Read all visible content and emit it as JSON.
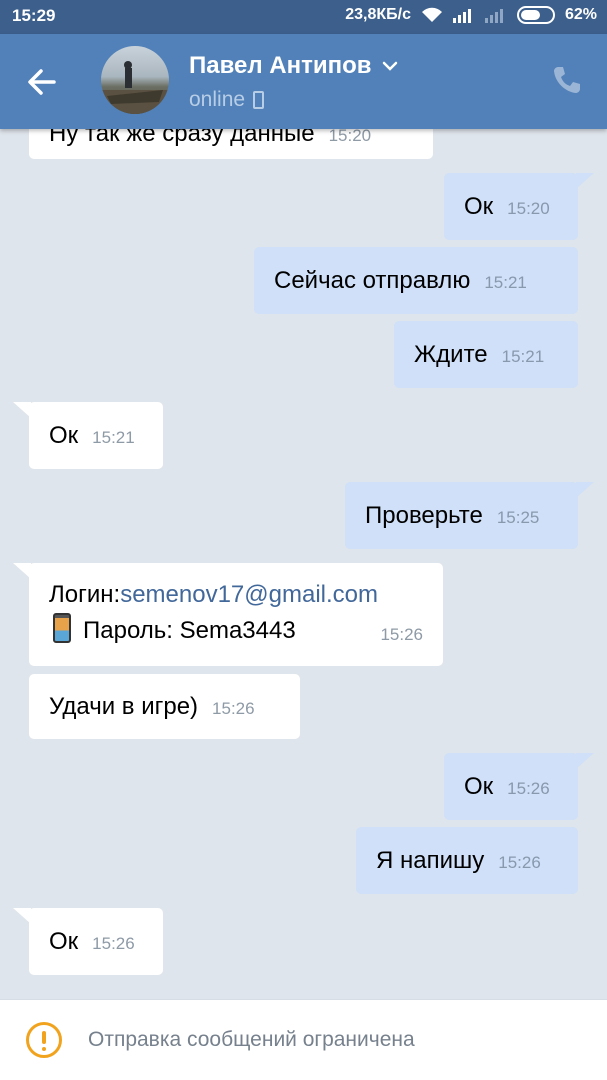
{
  "status_bar": {
    "time": "15:29",
    "speed": "23,8КБ/с",
    "battery": "62%",
    "battery_level": 0.62
  },
  "header": {
    "name": "Павел Антипов",
    "presence": "online"
  },
  "messages": [
    {
      "dir": "in",
      "text": "Ну так же сразу данные",
      "time": "15:20"
    },
    {
      "dir": "out",
      "text": "Ок",
      "time": "15:20"
    },
    {
      "dir": "out",
      "text": "Сейчас отправлю",
      "time": "15:21"
    },
    {
      "dir": "out",
      "text": "Ждите",
      "time": "15:21"
    },
    {
      "dir": "in",
      "text": "Ок",
      "time": "15:21"
    },
    {
      "dir": "out",
      "text": "Проверьте",
      "time": "15:25"
    },
    {
      "dir": "in",
      "login_label": "Логин:",
      "login_link": "semenov17@gmail.com",
      "password_text": "Пароль: Sema3443",
      "time": "15:26"
    },
    {
      "dir": "in",
      "text": "Удачи в игре)",
      "time": "15:26"
    },
    {
      "dir": "out",
      "text": "Ок",
      "time": "15:26"
    },
    {
      "dir": "out",
      "text": "Я напишу",
      "time": "15:26"
    },
    {
      "dir": "in",
      "text": "Ок",
      "time": "15:26"
    }
  ],
  "footer": {
    "notice": "Отправка сообщений ограничена"
  },
  "colors": {
    "header": "#5181b8",
    "status_bar": "#3c5f8c",
    "outgoing_bubble": "#cfe0f8",
    "incoming_bubble": "#ffffff",
    "background": "#dfe5ec",
    "warning": "#f2a31d"
  }
}
